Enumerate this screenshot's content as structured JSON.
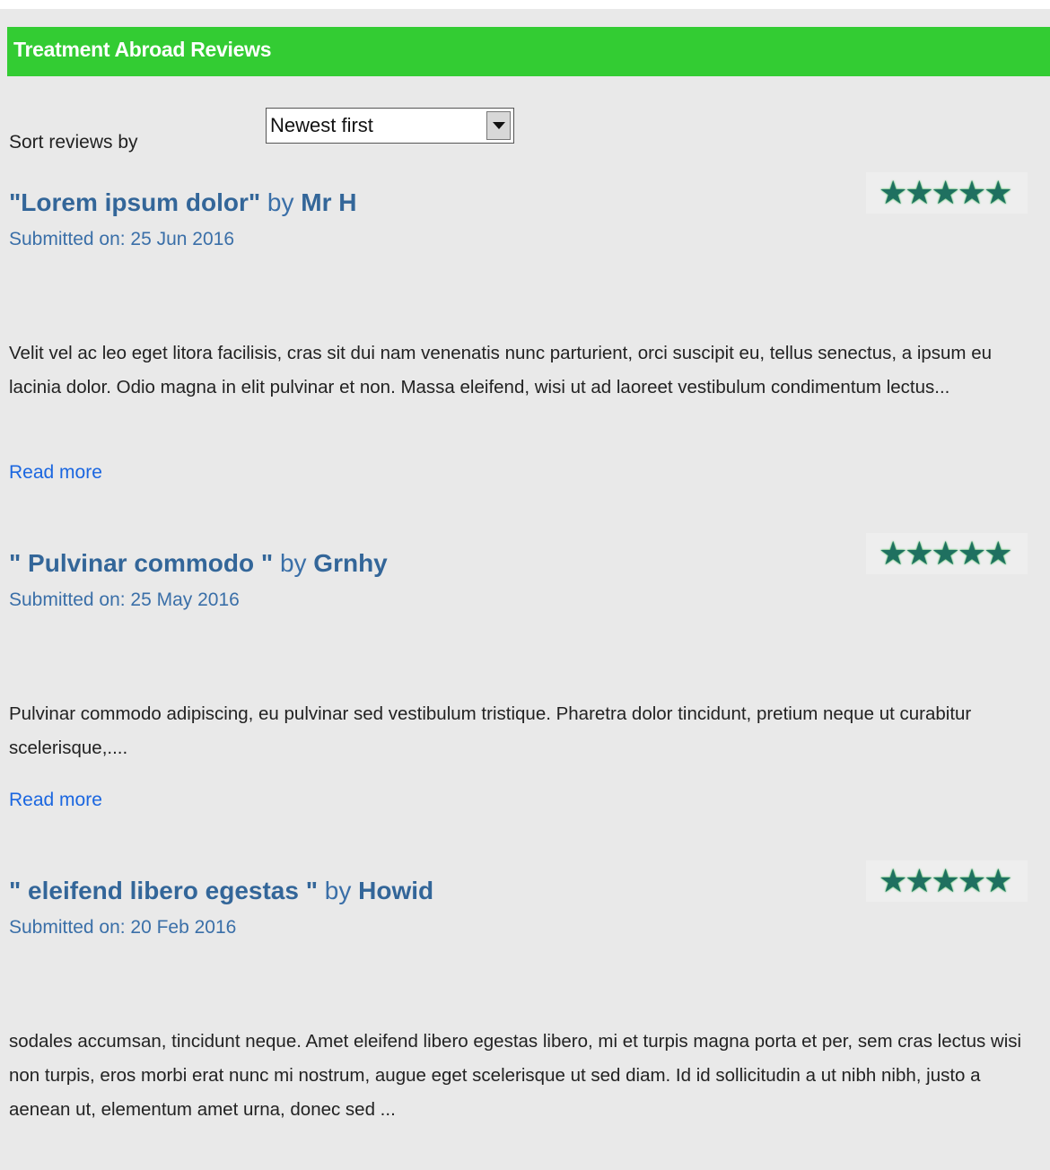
{
  "header": {
    "title": "Treatment Abroad Reviews"
  },
  "sort": {
    "label": "Sort reviews by",
    "selected": "Newest first"
  },
  "reviews": [
    {
      "title": "\"Lorem ipsum dolor\"",
      "by": "by",
      "author": "Mr H",
      "date": "Submitted on: 25 Jun 2016",
      "rating": 5,
      "stars": "★★★★★",
      "body": "Velit vel ac leo eget litora facilisis, cras sit dui nam venenatis nunc parturient, orci suscipit eu, tellus senectus, a ipsum eu lacinia dolor. Odio magna in elit pulvinar et non. Massa eleifend, wisi ut ad laoreet vestibulum condimentum lectus...",
      "read_more": "Read more"
    },
    {
      "title": "\" Pulvinar commodo \"",
      "by": "by",
      "author": "Grnhy",
      "date": "Submitted on: 25 May 2016",
      "rating": 5,
      "stars": "★★★★★",
      "body": "Pulvinar commodo adipiscing, eu pulvinar sed vestibulum tristique. Pharetra dolor tincidunt, pretium neque ut curabitur scelerisque,....",
      "read_more": "Read more"
    },
    {
      "title": "\" eleifend libero egestas \"",
      "by": "by",
      "author": "Howid",
      "date": "Submitted on: 20 Feb 2016",
      "rating": 5,
      "stars": "★★★★★",
      "body": "sodales accumsan, tincidunt neque. Amet eleifend libero egestas libero, mi et turpis magna porta et per, sem cras lectus wisi non turpis, eros morbi erat nunc mi nostrum, augue eget scelerisque ut sed diam. Id id sollicitudin a ut nibh nibh, justo a aenean ut, elementum amet urna, donec sed ..."
    }
  ]
}
